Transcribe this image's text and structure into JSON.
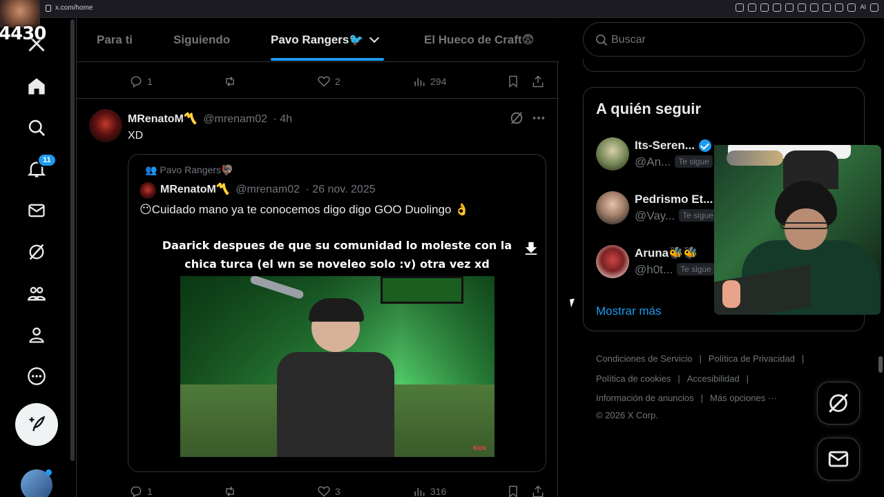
{
  "browser": {
    "url": "x.com/home",
    "ai_label": "AI"
  },
  "overlay": {
    "counter": "4430"
  },
  "nav": {
    "notifications_badge": "11"
  },
  "tabs": [
    {
      "label": "Para ti",
      "active": false
    },
    {
      "label": "Siguiendo",
      "active": false
    },
    {
      "label": "Pavo Rangers🐦",
      "active": true
    },
    {
      "label": "El Hueco de Craft😨",
      "active": false
    }
  ],
  "prev_tweet_actions": {
    "replies": "1",
    "likes": "2",
    "views": "294"
  },
  "tweet": {
    "name": "MRenatoM〽️",
    "handle": "@mrenam02",
    "time": "· 4h",
    "text": "XD",
    "quote": {
      "community": "Pavo Rangers🦃",
      "name": "MRenatoM〽️",
      "handle": "@mrenam02",
      "date": "· 26 nov. 2025",
      "text": "😶Cuidado mano ya te conocemos digo digo GOO Duolingo 👌",
      "media_caption_line1": "Daarick despues de que su comunidad lo moleste con la",
      "media_caption_line2": "chica turca (el wn se noveleo solo :v) otra vez xd",
      "watermark": "Kick"
    },
    "actions": {
      "replies": "1",
      "likes": "3",
      "views": "316"
    }
  },
  "search": {
    "placeholder": "Buscar"
  },
  "who_to_follow": {
    "title": "A quién seguir",
    "follows_you_label": "Te sigue",
    "users": [
      {
        "name": "Its-Seren...",
        "handle": "@An...",
        "verified": true
      },
      {
        "name": "Pedrismo Et...",
        "handle": "@Vay...",
        "verified": false
      },
      {
        "name": "Aruna🐝🐝",
        "handle": "@h0t...",
        "verified": false
      }
    ],
    "show_more": "Mostrar más"
  },
  "footer": {
    "links": [
      "Condiciones de Servicio",
      "Política de Privacidad",
      "Política de cookies",
      "Accesibilidad",
      "Información de anuncios",
      "Más opciones ···"
    ],
    "copyright": "© 2026 X Corp."
  },
  "colors": {
    "accent": "#1d9bf0",
    "text_primary": "#e7e9ea",
    "text_secondary": "#71767b",
    "border": "#2f3336"
  }
}
